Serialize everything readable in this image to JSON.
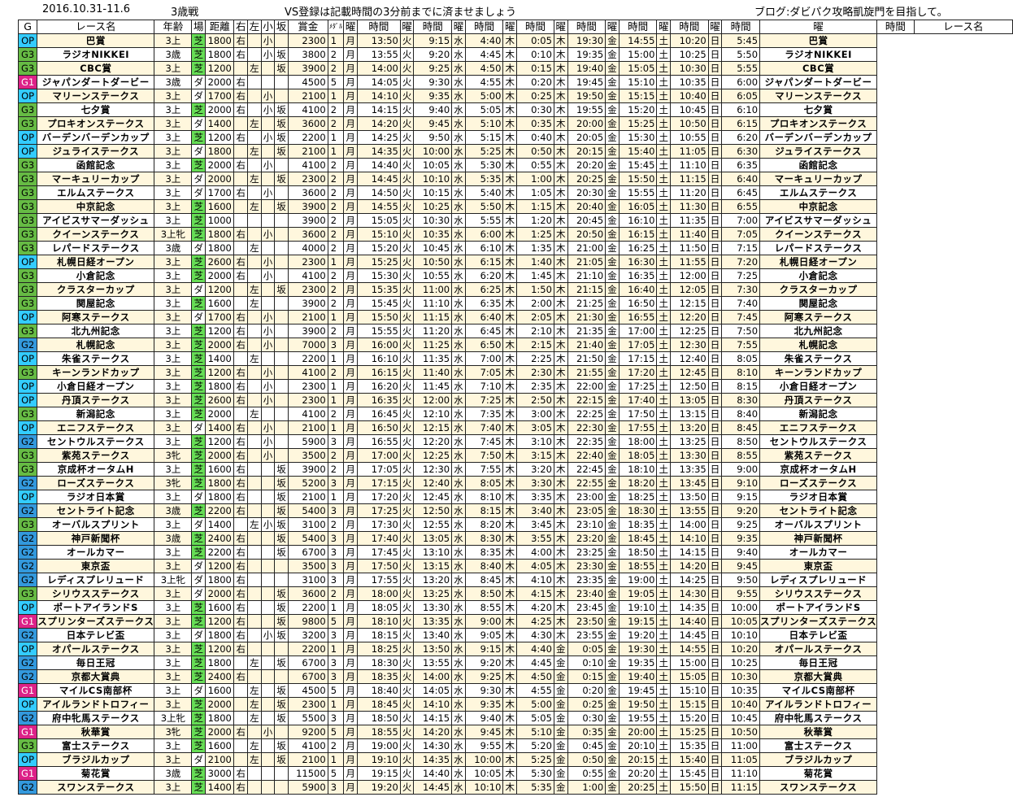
{
  "header": {
    "date_range": "2016.10.31-11.6",
    "category": "3歳戦",
    "notice": "VS登録は記載時間の3分前までに済ませましょう",
    "blog": "ブログ:ダビパク攻略凱旋門を目指して。"
  },
  "columns": [
    "G",
    "レース名",
    "年齢",
    "場",
    "距離",
    "右",
    "左",
    "小",
    "坂",
    "賞金",
    "ﾒﾀﾞﾙ",
    "曜",
    "時間",
    "曜",
    "時間",
    "曜",
    "時間",
    "曜",
    "時間",
    "曜",
    "時間",
    "曜",
    "時間",
    "曜",
    "時間",
    "曜",
    "時間",
    "曜",
    "時間",
    "レース名"
  ],
  "rows": [
    [
      "OP",
      "巴賞",
      "3上",
      "芝",
      "1800",
      "右",
      "",
      "小",
      "",
      "2300",
      "1",
      "月",
      "13:50",
      "火",
      "9:15",
      "水",
      "4:40",
      "木",
      "0:05",
      "木",
      "19:30",
      "金",
      "14:55",
      "土",
      "10:20",
      "日",
      "5:45"
    ],
    [
      "G3",
      "ラジオNIKKEI",
      "3歳",
      "芝",
      "1800",
      "右",
      "",
      "小",
      "坂",
      "3800",
      "2",
      "月",
      "13:55",
      "火",
      "9:20",
      "水",
      "4:45",
      "木",
      "0:10",
      "木",
      "19:35",
      "金",
      "15:00",
      "土",
      "10:25",
      "日",
      "5:50"
    ],
    [
      "G3",
      "CBC賞",
      "3上",
      "芝",
      "1200",
      "",
      "左",
      "",
      "坂",
      "3900",
      "2",
      "月",
      "14:00",
      "火",
      "9:25",
      "水",
      "4:50",
      "木",
      "0:15",
      "木",
      "19:40",
      "金",
      "15:05",
      "土",
      "10:30",
      "日",
      "5:55"
    ],
    [
      "G1",
      "ジャパンダートダービー",
      "3歳",
      "ダ",
      "2000",
      "右",
      "",
      "",
      "",
      "4500",
      "5",
      "月",
      "14:05",
      "火",
      "9:30",
      "水",
      "4:55",
      "木",
      "0:20",
      "木",
      "19:45",
      "金",
      "15:10",
      "土",
      "10:35",
      "日",
      "6:00"
    ],
    [
      "OP",
      "マリーンステークス",
      "3上",
      "ダ",
      "1700",
      "右",
      "",
      "小",
      "",
      "2100",
      "1",
      "月",
      "14:10",
      "火",
      "9:35",
      "水",
      "5:00",
      "木",
      "0:25",
      "木",
      "19:50",
      "金",
      "15:15",
      "土",
      "10:40",
      "日",
      "6:05"
    ],
    [
      "G3",
      "七夕賞",
      "3上",
      "芝",
      "2000",
      "右",
      "",
      "小",
      "坂",
      "4100",
      "2",
      "月",
      "14:15",
      "火",
      "9:40",
      "水",
      "5:05",
      "木",
      "0:30",
      "木",
      "19:55",
      "金",
      "15:20",
      "土",
      "10:45",
      "日",
      "6:10"
    ],
    [
      "G3",
      "プロキオンステークス",
      "3上",
      "ダ",
      "1400",
      "",
      "左",
      "",
      "坂",
      "3600",
      "2",
      "月",
      "14:20",
      "火",
      "9:45",
      "水",
      "5:10",
      "木",
      "0:35",
      "木",
      "20:00",
      "金",
      "15:25",
      "土",
      "10:50",
      "日",
      "6:15"
    ],
    [
      "OP",
      "バーデンバーデンカップ",
      "3上",
      "芝",
      "1200",
      "右",
      "",
      "小",
      "坂",
      "2200",
      "1",
      "月",
      "14:25",
      "火",
      "9:50",
      "水",
      "5:15",
      "木",
      "0:40",
      "木",
      "20:05",
      "金",
      "15:30",
      "土",
      "10:55",
      "日",
      "6:20"
    ],
    [
      "OP",
      "ジュライステークス",
      "3上",
      "ダ",
      "1800",
      "",
      "左",
      "",
      "坂",
      "2100",
      "1",
      "月",
      "14:35",
      "火",
      "10:00",
      "水",
      "5:25",
      "木",
      "0:50",
      "木",
      "20:15",
      "金",
      "15:40",
      "土",
      "11:05",
      "日",
      "6:30"
    ],
    [
      "G3",
      "函館記念",
      "3上",
      "芝",
      "2000",
      "右",
      "",
      "小",
      "",
      "4100",
      "2",
      "月",
      "14:40",
      "火",
      "10:05",
      "水",
      "5:30",
      "木",
      "0:55",
      "木",
      "20:20",
      "金",
      "15:45",
      "土",
      "11:10",
      "日",
      "6:35"
    ],
    [
      "G3",
      "マーキュリーカップ",
      "3上",
      "ダ",
      "2000",
      "",
      "左",
      "",
      "坂",
      "2300",
      "2",
      "月",
      "14:45",
      "火",
      "10:10",
      "水",
      "5:35",
      "木",
      "1:00",
      "木",
      "20:25",
      "金",
      "15:50",
      "土",
      "11:15",
      "日",
      "6:40"
    ],
    [
      "G3",
      "エルムステークス",
      "3上",
      "ダ",
      "1700",
      "右",
      "",
      "小",
      "",
      "3600",
      "2",
      "月",
      "14:50",
      "火",
      "10:15",
      "水",
      "5:40",
      "木",
      "1:05",
      "木",
      "20:30",
      "金",
      "15:55",
      "土",
      "11:20",
      "日",
      "6:45"
    ],
    [
      "G3",
      "中京記念",
      "3上",
      "芝",
      "1600",
      "",
      "左",
      "",
      "坂",
      "3900",
      "2",
      "月",
      "14:55",
      "火",
      "10:25",
      "水",
      "5:50",
      "木",
      "1:15",
      "木",
      "20:40",
      "金",
      "16:05",
      "土",
      "11:30",
      "日",
      "6:55"
    ],
    [
      "G3",
      "アイビスサマーダッシュ",
      "3上",
      "芝",
      "1000",
      "",
      "",
      "",
      "",
      "3900",
      "2",
      "月",
      "15:05",
      "火",
      "10:30",
      "水",
      "5:55",
      "木",
      "1:20",
      "木",
      "20:45",
      "金",
      "16:10",
      "土",
      "11:35",
      "日",
      "7:00"
    ],
    [
      "G3",
      "クイーンステークス",
      "3上牝",
      "芝",
      "1800",
      "右",
      "",
      "小",
      "",
      "3600",
      "2",
      "月",
      "15:10",
      "火",
      "10:35",
      "水",
      "6:00",
      "木",
      "1:25",
      "木",
      "20:50",
      "金",
      "16:15",
      "土",
      "11:40",
      "日",
      "7:05"
    ],
    [
      "G3",
      "レパードステークス",
      "3歳",
      "ダ",
      "1800",
      "",
      "左",
      "",
      "",
      "4000",
      "2",
      "月",
      "15:20",
      "火",
      "10:45",
      "水",
      "6:10",
      "木",
      "1:35",
      "木",
      "21:00",
      "金",
      "16:25",
      "土",
      "11:50",
      "日",
      "7:15"
    ],
    [
      "OP",
      "札幌日経オープン",
      "3上",
      "芝",
      "2600",
      "右",
      "",
      "小",
      "",
      "2300",
      "1",
      "月",
      "15:25",
      "火",
      "10:50",
      "水",
      "6:15",
      "木",
      "1:40",
      "木",
      "21:05",
      "金",
      "16:30",
      "土",
      "11:55",
      "日",
      "7:20"
    ],
    [
      "G3",
      "小倉記念",
      "3上",
      "芝",
      "2000",
      "右",
      "",
      "小",
      "",
      "4100",
      "2",
      "月",
      "15:30",
      "火",
      "10:55",
      "水",
      "6:20",
      "木",
      "1:45",
      "木",
      "21:10",
      "金",
      "16:35",
      "土",
      "12:00",
      "日",
      "7:25"
    ],
    [
      "G3",
      "クラスターカップ",
      "3上",
      "ダ",
      "1200",
      "",
      "左",
      "",
      "坂",
      "2300",
      "2",
      "月",
      "15:35",
      "火",
      "11:00",
      "水",
      "6:25",
      "木",
      "1:50",
      "木",
      "21:15",
      "金",
      "16:40",
      "土",
      "12:05",
      "日",
      "7:30"
    ],
    [
      "G3",
      "関屋記念",
      "3上",
      "芝",
      "1600",
      "",
      "左",
      "",
      "",
      "3900",
      "2",
      "月",
      "15:45",
      "火",
      "11:10",
      "水",
      "6:35",
      "木",
      "2:00",
      "木",
      "21:25",
      "金",
      "16:50",
      "土",
      "12:15",
      "日",
      "7:40"
    ],
    [
      "OP",
      "阿寒ステークス",
      "3上",
      "ダ",
      "1700",
      "右",
      "",
      "小",
      "",
      "2100",
      "1",
      "月",
      "15:50",
      "火",
      "11:15",
      "水",
      "6:40",
      "木",
      "2:05",
      "木",
      "21:30",
      "金",
      "16:55",
      "土",
      "12:20",
      "日",
      "7:45"
    ],
    [
      "G3",
      "北九州記念",
      "3上",
      "芝",
      "1200",
      "右",
      "",
      "小",
      "",
      "3900",
      "2",
      "月",
      "15:55",
      "火",
      "11:20",
      "水",
      "6:45",
      "木",
      "2:10",
      "木",
      "21:35",
      "金",
      "17:00",
      "土",
      "12:25",
      "日",
      "7:50"
    ],
    [
      "G2",
      "札幌記念",
      "3上",
      "芝",
      "2000",
      "右",
      "",
      "小",
      "",
      "7000",
      "3",
      "月",
      "16:00",
      "火",
      "11:25",
      "水",
      "6:50",
      "木",
      "2:15",
      "木",
      "21:40",
      "金",
      "17:05",
      "土",
      "12:30",
      "日",
      "7:55"
    ],
    [
      "OP",
      "朱雀ステークス",
      "3上",
      "芝",
      "1400",
      "",
      "左",
      "",
      "",
      "2200",
      "1",
      "月",
      "16:10",
      "火",
      "11:35",
      "水",
      "7:00",
      "木",
      "2:25",
      "木",
      "21:50",
      "金",
      "17:15",
      "土",
      "12:40",
      "日",
      "8:05"
    ],
    [
      "G3",
      "キーンランドカップ",
      "3上",
      "芝",
      "1200",
      "右",
      "",
      "小",
      "",
      "4100",
      "2",
      "月",
      "16:15",
      "火",
      "11:40",
      "水",
      "7:05",
      "木",
      "2:30",
      "木",
      "21:55",
      "金",
      "17:20",
      "土",
      "12:45",
      "日",
      "8:10"
    ],
    [
      "OP",
      "小倉日経オープン",
      "3上",
      "芝",
      "1800",
      "右",
      "",
      "小",
      "",
      "2300",
      "1",
      "月",
      "16:20",
      "火",
      "11:45",
      "水",
      "7:10",
      "木",
      "2:35",
      "木",
      "22:00",
      "金",
      "17:25",
      "土",
      "12:50",
      "日",
      "8:15"
    ],
    [
      "OP",
      "丹頂ステークス",
      "3上",
      "芝",
      "2600",
      "右",
      "",
      "小",
      "",
      "2300",
      "1",
      "月",
      "16:35",
      "火",
      "12:00",
      "水",
      "7:25",
      "木",
      "2:50",
      "木",
      "22:15",
      "金",
      "17:40",
      "土",
      "13:05",
      "日",
      "8:30"
    ],
    [
      "G3",
      "新潟記念",
      "3上",
      "芝",
      "2000",
      "",
      "左",
      "",
      "",
      "4100",
      "2",
      "月",
      "16:45",
      "火",
      "12:10",
      "水",
      "7:35",
      "木",
      "3:00",
      "木",
      "22:25",
      "金",
      "17:50",
      "土",
      "13:15",
      "日",
      "8:40"
    ],
    [
      "OP",
      "エニフステークス",
      "3上",
      "ダ",
      "1400",
      "右",
      "",
      "小",
      "",
      "2100",
      "1",
      "月",
      "16:50",
      "火",
      "12:15",
      "水",
      "7:40",
      "木",
      "3:05",
      "木",
      "22:30",
      "金",
      "17:55",
      "土",
      "13:20",
      "日",
      "8:45"
    ],
    [
      "G2",
      "セントウルステークス",
      "3上",
      "芝",
      "1200",
      "右",
      "",
      "小",
      "",
      "5900",
      "3",
      "月",
      "16:55",
      "火",
      "12:20",
      "水",
      "7:45",
      "木",
      "3:10",
      "木",
      "22:35",
      "金",
      "18:00",
      "土",
      "13:25",
      "日",
      "8:50"
    ],
    [
      "G3",
      "紫苑ステークス",
      "3牝",
      "芝",
      "2000",
      "右",
      "",
      "小",
      "",
      "3500",
      "2",
      "月",
      "17:00",
      "火",
      "12:25",
      "水",
      "7:50",
      "木",
      "3:15",
      "木",
      "22:40",
      "金",
      "18:05",
      "土",
      "13:30",
      "日",
      "8:55"
    ],
    [
      "G3",
      "京成杯オータムH",
      "3上",
      "芝",
      "1600",
      "右",
      "",
      "",
      "坂",
      "3900",
      "2",
      "月",
      "17:05",
      "火",
      "12:30",
      "水",
      "7:55",
      "木",
      "3:20",
      "木",
      "22:45",
      "金",
      "18:10",
      "土",
      "13:35",
      "日",
      "9:00"
    ],
    [
      "G2",
      "ローズステークス",
      "3牝",
      "芝",
      "1800",
      "右",
      "",
      "",
      "坂",
      "5200",
      "3",
      "月",
      "17:15",
      "火",
      "12:40",
      "水",
      "8:05",
      "木",
      "3:30",
      "木",
      "22:55",
      "金",
      "18:20",
      "土",
      "13:45",
      "日",
      "9:10"
    ],
    [
      "OP",
      "ラジオ日本賞",
      "3上",
      "ダ",
      "1800",
      "右",
      "",
      "",
      "坂",
      "2100",
      "1",
      "月",
      "17:20",
      "火",
      "12:45",
      "水",
      "8:10",
      "木",
      "3:35",
      "木",
      "23:00",
      "金",
      "18:25",
      "土",
      "13:50",
      "日",
      "9:15"
    ],
    [
      "G2",
      "セントライト記念",
      "3歳",
      "芝",
      "2200",
      "右",
      "",
      "",
      "坂",
      "5400",
      "3",
      "月",
      "17:25",
      "火",
      "12:50",
      "水",
      "8:15",
      "木",
      "3:40",
      "木",
      "23:05",
      "金",
      "18:30",
      "土",
      "13:55",
      "日",
      "9:20"
    ],
    [
      "G3",
      "オーバルスプリント",
      "3上",
      "ダ",
      "1400",
      "",
      "左",
      "小",
      "坂",
      "3100",
      "2",
      "月",
      "17:30",
      "火",
      "12:55",
      "水",
      "8:20",
      "木",
      "3:45",
      "木",
      "23:10",
      "金",
      "18:35",
      "土",
      "14:00",
      "日",
      "9:25"
    ],
    [
      "G2",
      "神戸新聞杯",
      "3歳",
      "芝",
      "2400",
      "右",
      "",
      "",
      "坂",
      "5400",
      "3",
      "月",
      "17:40",
      "火",
      "13:05",
      "水",
      "8:30",
      "木",
      "3:55",
      "木",
      "23:20",
      "金",
      "18:45",
      "土",
      "14:10",
      "日",
      "9:35"
    ],
    [
      "G2",
      "オールカマー",
      "3上",
      "芝",
      "2200",
      "右",
      "",
      "",
      "坂",
      "6700",
      "3",
      "月",
      "17:45",
      "火",
      "13:10",
      "水",
      "8:35",
      "木",
      "4:00",
      "木",
      "23:25",
      "金",
      "18:50",
      "土",
      "14:15",
      "日",
      "9:40"
    ],
    [
      "G2",
      "東京盃",
      "3上",
      "ダ",
      "1200",
      "右",
      "",
      "",
      "",
      "3500",
      "3",
      "月",
      "17:50",
      "火",
      "13:15",
      "水",
      "8:40",
      "木",
      "4:05",
      "木",
      "23:30",
      "金",
      "18:55",
      "土",
      "14:20",
      "日",
      "9:45"
    ],
    [
      "G2",
      "レディスプレリュード",
      "3上牝",
      "ダ",
      "1800",
      "右",
      "",
      "",
      "",
      "3100",
      "3",
      "月",
      "17:55",
      "火",
      "13:20",
      "水",
      "8:45",
      "木",
      "4:10",
      "木",
      "23:35",
      "金",
      "19:00",
      "土",
      "14:25",
      "日",
      "9:50"
    ],
    [
      "G3",
      "シリウスステークス",
      "3上",
      "ダ",
      "2000",
      "右",
      "",
      "",
      "坂",
      "3600",
      "2",
      "月",
      "18:00",
      "火",
      "13:25",
      "水",
      "8:50",
      "木",
      "4:15",
      "木",
      "23:40",
      "金",
      "19:05",
      "土",
      "14:30",
      "日",
      "9:55"
    ],
    [
      "OP",
      "ポートアイランドS",
      "3上",
      "芝",
      "1600",
      "右",
      "",
      "",
      "坂",
      "2200",
      "1",
      "月",
      "18:05",
      "火",
      "13:30",
      "水",
      "8:55",
      "木",
      "4:20",
      "木",
      "23:45",
      "金",
      "19:10",
      "土",
      "14:35",
      "日",
      "10:00"
    ],
    [
      "G1",
      "スプリンターズステークス",
      "3上",
      "芝",
      "1200",
      "右",
      "",
      "",
      "坂",
      "9800",
      "5",
      "月",
      "18:10",
      "火",
      "13:35",
      "水",
      "9:00",
      "木",
      "4:25",
      "木",
      "23:50",
      "金",
      "19:15",
      "土",
      "14:40",
      "日",
      "10:05"
    ],
    [
      "G2",
      "日本テレビ盃",
      "3上",
      "ダ",
      "1800",
      "右",
      "",
      "小",
      "坂",
      "3200",
      "3",
      "月",
      "18:15",
      "火",
      "13:40",
      "水",
      "9:05",
      "木",
      "4:30",
      "木",
      "23:55",
      "金",
      "19:20",
      "土",
      "14:45",
      "日",
      "10:10"
    ],
    [
      "OP",
      "オパールステークス",
      "3上",
      "芝",
      "1200",
      "右",
      "",
      "",
      "",
      "2200",
      "1",
      "月",
      "18:25",
      "火",
      "13:50",
      "水",
      "9:15",
      "木",
      "4:40",
      "金",
      "0:05",
      "金",
      "19:30",
      "土",
      "14:55",
      "日",
      "10:20"
    ],
    [
      "G2",
      "毎日王冠",
      "3上",
      "芝",
      "1800",
      "",
      "左",
      "",
      "坂",
      "6700",
      "3",
      "月",
      "18:30",
      "火",
      "13:55",
      "水",
      "9:20",
      "木",
      "4:45",
      "金",
      "0:10",
      "金",
      "19:35",
      "土",
      "15:00",
      "日",
      "10:25"
    ],
    [
      "G2",
      "京都大賞典",
      "3上",
      "芝",
      "2400",
      "右",
      "",
      "",
      "",
      "6700",
      "3",
      "月",
      "18:35",
      "火",
      "14:00",
      "水",
      "9:25",
      "木",
      "4:50",
      "金",
      "0:15",
      "金",
      "19:40",
      "土",
      "15:05",
      "日",
      "10:30"
    ],
    [
      "G1",
      "マイルCS南部杯",
      "3上",
      "ダ",
      "1600",
      "",
      "左",
      "",
      "坂",
      "4500",
      "5",
      "月",
      "18:40",
      "火",
      "14:05",
      "水",
      "9:30",
      "木",
      "4:55",
      "金",
      "0:20",
      "金",
      "19:45",
      "土",
      "15:10",
      "日",
      "10:35"
    ],
    [
      "OP",
      "アイルランドトロフィー",
      "3上",
      "芝",
      "2000",
      "",
      "左",
      "",
      "坂",
      "2300",
      "1",
      "月",
      "18:45",
      "火",
      "14:10",
      "水",
      "9:35",
      "木",
      "5:00",
      "金",
      "0:25",
      "金",
      "19:50",
      "土",
      "15:15",
      "日",
      "10:40"
    ],
    [
      "G2",
      "府中牝馬ステークス",
      "3上牝",
      "芝",
      "1800",
      "",
      "左",
      "",
      "坂",
      "5500",
      "3",
      "月",
      "18:50",
      "火",
      "14:15",
      "水",
      "9:40",
      "木",
      "5:05",
      "金",
      "0:30",
      "金",
      "19:55",
      "土",
      "15:20",
      "日",
      "10:45"
    ],
    [
      "G1",
      "秋華賞",
      "3牝",
      "芝",
      "2000",
      "右",
      "",
      "小",
      "",
      "9200",
      "5",
      "月",
      "18:55",
      "火",
      "14:20",
      "水",
      "9:45",
      "木",
      "5:10",
      "金",
      "0:35",
      "金",
      "20:00",
      "土",
      "15:25",
      "日",
      "10:50"
    ],
    [
      "G3",
      "富士ステークス",
      "3上",
      "芝",
      "1600",
      "",
      "左",
      "",
      "坂",
      "4100",
      "2",
      "月",
      "19:00",
      "火",
      "14:30",
      "水",
      "9:55",
      "木",
      "5:20",
      "金",
      "0:45",
      "金",
      "20:10",
      "土",
      "15:35",
      "日",
      "11:00"
    ],
    [
      "OP",
      "ブラジルカップ",
      "3上",
      "ダ",
      "2100",
      "",
      "左",
      "",
      "坂",
      "2100",
      "1",
      "月",
      "19:10",
      "火",
      "14:35",
      "水",
      "10:00",
      "木",
      "5:25",
      "金",
      "0:50",
      "金",
      "20:15",
      "土",
      "15:40",
      "日",
      "11:05"
    ],
    [
      "G1",
      "菊花賞",
      "3歳",
      "芝",
      "3000",
      "右",
      "",
      "",
      "",
      "11500",
      "5",
      "月",
      "19:15",
      "火",
      "14:40",
      "水",
      "10:05",
      "木",
      "5:30",
      "金",
      "0:55",
      "金",
      "20:20",
      "土",
      "15:45",
      "日",
      "11:10"
    ],
    [
      "G2",
      "スワンステークス",
      "3上",
      "芝",
      "1400",
      "右",
      "",
      "",
      "",
      "5900",
      "3",
      "月",
      "19:20",
      "火",
      "14:45",
      "水",
      "10:10",
      "木",
      "5:35",
      "金",
      "1:00",
      "金",
      "20:25",
      "土",
      "15:50",
      "日",
      "11:15"
    ]
  ],
  "colors": {
    "OP": "#33ccff",
    "G3": "#66bb44",
    "G2": "#3399dd",
    "G1": "#dd2288",
    "turf": "#66dd55",
    "cream": "#fff7dd"
  }
}
